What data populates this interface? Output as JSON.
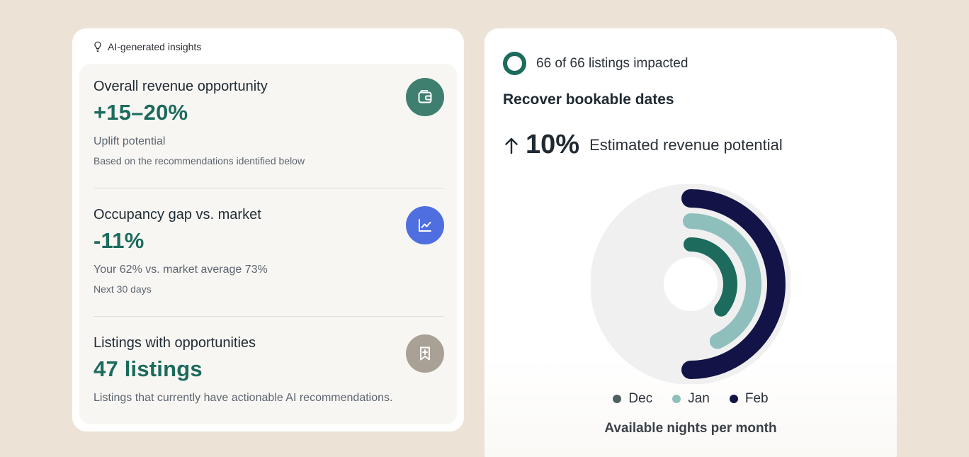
{
  "insights": {
    "header_label": "AI-generated insights",
    "sections": [
      {
        "title": "Overall revenue opportunity",
        "value": "+15–20%",
        "sub": "Uplift potential",
        "note": "Based on the recommendations identified below",
        "icon": "wallet-icon",
        "icon_color": "#3f7f70"
      },
      {
        "title": "Occupancy gap vs. market",
        "value": "-11%",
        "sub": "Your 62% vs. market average 73%",
        "note": "Next 30 days",
        "icon": "line-chart-icon",
        "icon_color": "#4f6fe0"
      },
      {
        "title": "Listings with opportunities",
        "value": "47 listings",
        "sub": "Listings that currently have actionable AI recommendations.",
        "icon": "bookmark-plus-icon",
        "icon_color": "#aaa196"
      }
    ]
  },
  "impact": {
    "label": "66 of 66 listings impacted",
    "ring_color": "#1c6b5c"
  },
  "recover": {
    "title": "Recover bookable dates",
    "estimate_value": "10%",
    "estimate_label": "Estimated revenue potential"
  },
  "chart_data": {
    "type": "radial-bar",
    "title": "",
    "caption": "Available nights per month",
    "max": 1,
    "series": [
      {
        "name": "Dec",
        "value": 0.36,
        "color": "#1c6b5c"
      },
      {
        "name": "Jan",
        "value": 0.43,
        "color": "#8fbfbc"
      },
      {
        "name": "Feb",
        "value": 0.5,
        "color": "#121347"
      }
    ],
    "track_color": "#f0f0f0"
  }
}
